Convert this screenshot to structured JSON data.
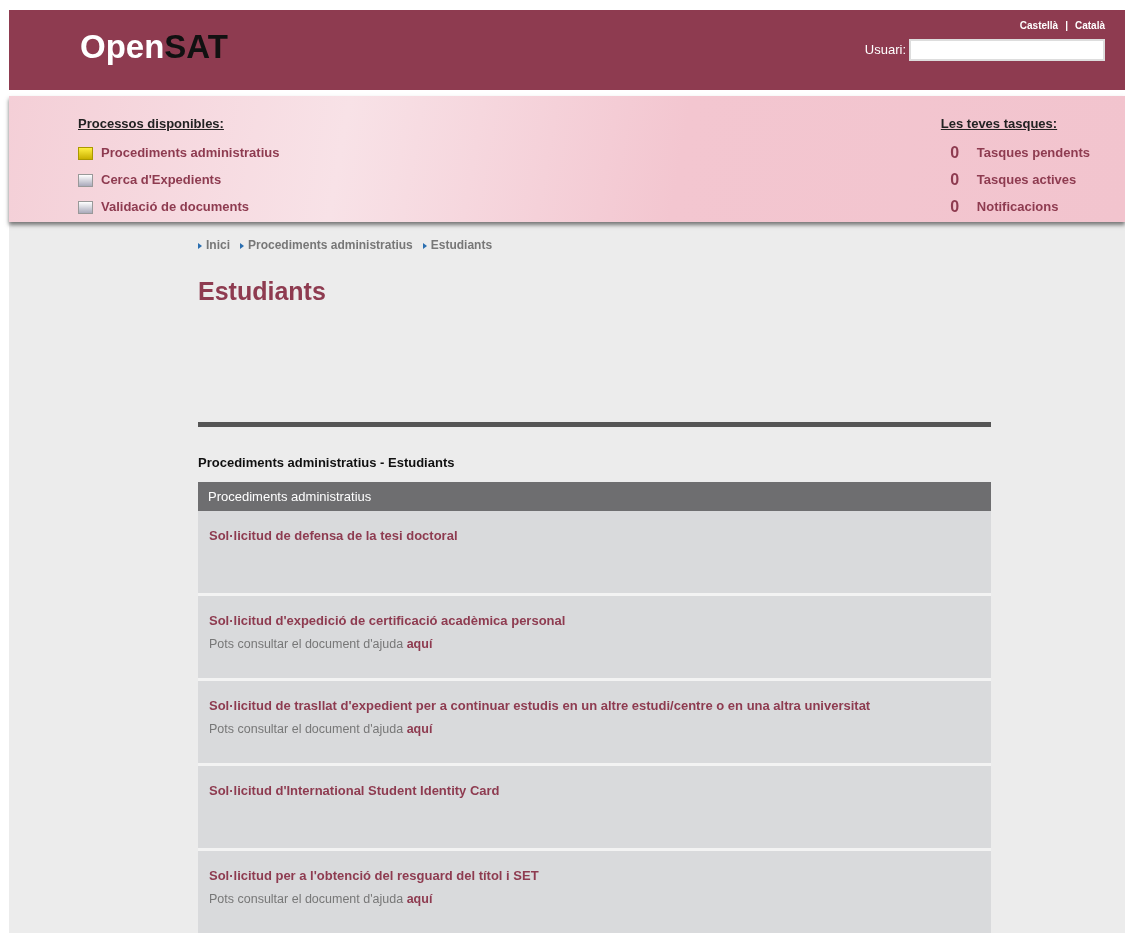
{
  "header": {
    "logo_light": "Open",
    "logo_dark": "SAT",
    "languages": [
      "Castellà",
      "Català"
    ],
    "language_separator": "|",
    "user_label": "Usuari:"
  },
  "processes": {
    "title": "Processos disponibles:",
    "items": [
      {
        "label": "Procediments administratius",
        "selected": true
      },
      {
        "label": "Cerca d'Expedients",
        "selected": false
      },
      {
        "label": "Validació de documents",
        "selected": false
      }
    ]
  },
  "tasks": {
    "title": "Les teves tasques:",
    "items": [
      {
        "count": "0",
        "label": "Tasques pendents"
      },
      {
        "count": "0",
        "label": "Tasques actives"
      },
      {
        "count": "0",
        "label": "Notificacions"
      }
    ]
  },
  "breadcrumb": [
    "Inici",
    "Procediments administratius",
    "Estudiants"
  ],
  "page_title": "Estudiants",
  "section_title": "Procediments administratius - Estudiants",
  "table": {
    "header": "Procediments administratius",
    "rows": [
      {
        "title": "Sol·licitud de defensa de la tesi doctoral"
      },
      {
        "title": "Sol·licitud d'expedició de certificació acadèmica personal",
        "help": "Pots consultar el document d'ajuda",
        "help_link": "aquí"
      },
      {
        "title": "Sol·licitud de trasllat d'expedient per a continuar estudis en un altre estudi/centre o en una altra universitat",
        "help": "Pots consultar el document d'ajuda",
        "help_link": "aquí"
      },
      {
        "title": "Sol·licitud d'International Student Identity Card"
      },
      {
        "title": "Sol·licitud per a l'obtenció del resguard del títol i SET",
        "help": "Pots consultar el document d'ajuda",
        "help_link": "aquí"
      }
    ]
  }
}
